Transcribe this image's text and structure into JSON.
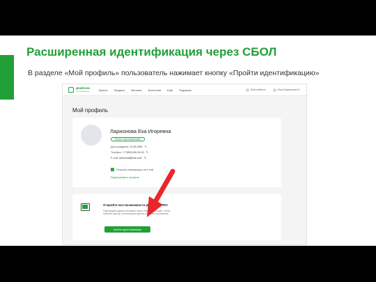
{
  "slide": {
    "title": "Расширенная идентификация через СБОЛ",
    "subtitle": "В разделе «Мой профиль» пользователь нажимает кнопку «Пройти идентификацию»"
  },
  "colors": {
    "accent": "#21a038",
    "arrow": "#e8272d"
  },
  "nav": {
    "logo": "ДомКлик",
    "logo_sub": "от Сбербанка",
    "items": [
      "Купить",
      "Продать",
      "Ипотека",
      "Агентства",
      "Ещё",
      "Подписки"
    ],
    "right": [
      "Мой кабинет",
      "ЕкатЛарионова В"
    ]
  },
  "page_heading": "Мой профиль",
  "profile": {
    "name": "Ларионова Ека Игоревна",
    "badge": "Пройти идентификацию",
    "birth_label": "Дата рождения:",
    "birth_value": "21.05.1990",
    "phone_label": "Телефон:",
    "phone_value": "+7 (900) 000-00 00",
    "email_label": "E-mail:",
    "email_value": "larionova@mail.com",
    "consent": "Получать информацию на e-mail",
    "edit_link": "Редактировать профиль"
  },
  "pro": {
    "title": "Откройте все возможности ДомКлик PRO",
    "description": "Подтвердите данные профиля через Сбербанк Онлайн, чтобы получить доступ к регистрации сделок и ипотеке на ДомКлик",
    "button": "Пройти идентификацию"
  },
  "icons": {
    "edit": "pencil-icon",
    "pro": "monitor-icon",
    "pointer": "red-arrow-icon"
  }
}
